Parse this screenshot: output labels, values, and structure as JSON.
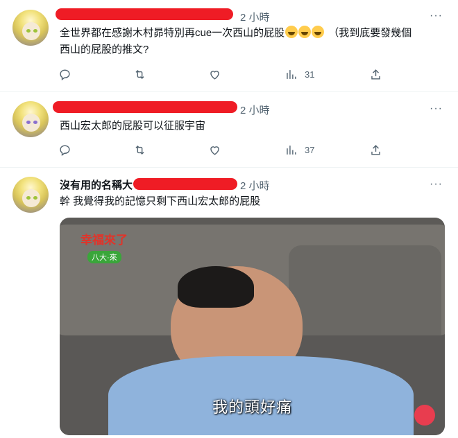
{
  "tweets": [
    {
      "time": "2 小時",
      "text_line1": "全世界都在感謝木村昴特別再cue一次西山的屁股",
      "text_line1_tail": "（我到底要發幾個",
      "text_line2": "西山的屁股的推文?",
      "emoji": [
        "rolling-on-floor-laughing",
        "rolling-on-floor-laughing",
        "rolling-on-floor-laughing"
      ],
      "views": "31"
    },
    {
      "time": "2 小時",
      "text_line1": "西山宏太郎的屁股可以征服宇宙",
      "views": "37"
    },
    {
      "name": "沒有用的名稱大",
      "time": "2 小時",
      "text_line1": "幹 我覺得我的記憶只剩下西山宏太郎的屁股",
      "media": {
        "logo": "幸福來了",
        "logo_sub": "八大·來",
        "caption": "我的頭好痛"
      }
    }
  ],
  "more_label": "···",
  "colors": {
    "redaction": "#ef1c25",
    "muted": "#536471",
    "text": "#0f1419"
  }
}
